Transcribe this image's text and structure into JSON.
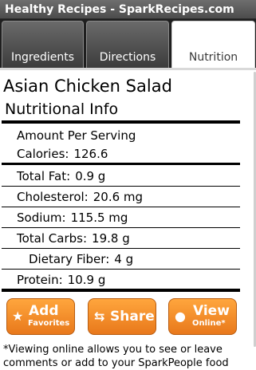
{
  "app": {
    "title": "Healthy Recipes - SparkRecipes.com"
  },
  "tabs": [
    {
      "label": "Ingredients"
    },
    {
      "label": "Directions"
    },
    {
      "label": "Nutrition"
    }
  ],
  "recipe": {
    "title": "Asian Chicken Salad",
    "section_title": "Nutritional Info",
    "amount_per_serving": "Amount Per Serving",
    "calories": {
      "label": "Calories",
      "value": "126.6"
    },
    "total_fat": {
      "label": "Total Fat",
      "value": "0.9 g"
    },
    "cholesterol": {
      "label": "Cholesterol",
      "value": "20.6 mg"
    },
    "sodium": {
      "label": "Sodium",
      "value": "115.5 mg"
    },
    "total_carbs": {
      "label": "Total Carbs",
      "value": "19.8 g"
    },
    "dietary_fiber": {
      "label": "Dietary Fiber",
      "value": "4 g"
    },
    "protein": {
      "label": "Protein",
      "value": "10.9 g"
    }
  },
  "buttons": {
    "add_favorites": {
      "line1": "Add",
      "line2": "Favorites"
    },
    "share": {
      "label": "Share"
    },
    "view_online": {
      "line1": "View",
      "line2": "Online*"
    }
  },
  "footnote": "*Viewing online allows you to see or leave comments or add to your SparkPeople food"
}
